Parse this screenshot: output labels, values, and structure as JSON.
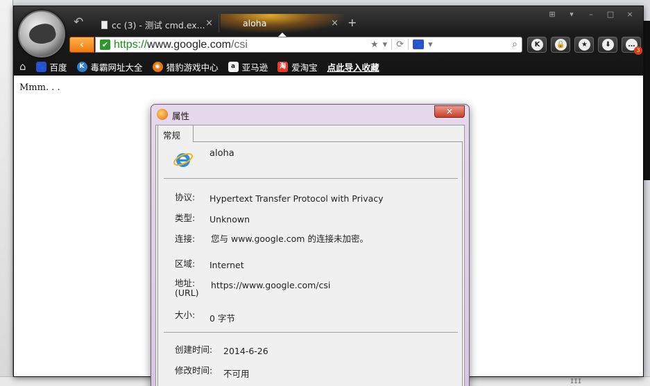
{
  "browser": {
    "tabs": [
      {
        "label": "cc (3) - 测试 cmd.ex...",
        "close": "×"
      },
      {
        "label": "aloha",
        "close": "×"
      }
    ],
    "new_tab": "+",
    "window_controls": [
      "⊞",
      "▾",
      "–",
      "□",
      "×"
    ],
    "back_label": "‹",
    "url": {
      "scheme": "https://",
      "host": "www.google.com",
      "path": "/csi"
    },
    "right_tools": [
      "K",
      "🔒",
      "★",
      "⬇",
      "…"
    ],
    "downloads_badge": "3"
  },
  "bookmarks": {
    "items": [
      {
        "label": "百度",
        "icon": "baidu-paw-icon",
        "color": "#2a4fd0",
        "glyph": "🐾"
      },
      {
        "label": "毒霸网址大全",
        "icon": "kingsoft-k-icon",
        "color": "#2a7fd0",
        "glyph": "K"
      },
      {
        "label": "猎豹游戏中心",
        "icon": "liebao-game-icon",
        "color": "#e8780a",
        "glyph": "◉"
      },
      {
        "label": "亚马逊",
        "icon": "amazon-icon",
        "color": "#f4f4f4",
        "glyph": "a"
      },
      {
        "label": "爱淘宝",
        "icon": "taobao-icon",
        "color": "#e83a2a",
        "glyph": "淘"
      }
    ],
    "import_label": "点此导入收藏"
  },
  "page": {
    "text": "Mmm. . ."
  },
  "dialog": {
    "title": "属性",
    "close": "✕",
    "tab_label": "常规",
    "file_name": "aloha",
    "properties": {
      "protocol": {
        "label": "协议:",
        "value": "Hypertext Transfer Protocol with Privacy"
      },
      "type": {
        "label": "类型:",
        "value": "Unknown"
      },
      "connection": {
        "label": "连接:",
        "value": "您与 www.google.com 的连接未加密。"
      },
      "zone": {
        "label": "区域:",
        "value": "Internet"
      },
      "address": {
        "label": "地址:",
        "label2": "(URL)",
        "value": "https://www.google.com/csi"
      },
      "size": {
        "label": "大小:",
        "value": "0  字节"
      },
      "created": {
        "label": "创建时间:",
        "value": "2014-6-26"
      },
      "modified": {
        "label": "修改时间:",
        "value": "不可用"
      }
    }
  },
  "desktop": {
    "bottom_glyph": "III"
  },
  "colors": {
    "accent_orange": "#f07a10",
    "secure_green": "#1d8a1d",
    "dialog_frame": "#e6d8ec"
  }
}
